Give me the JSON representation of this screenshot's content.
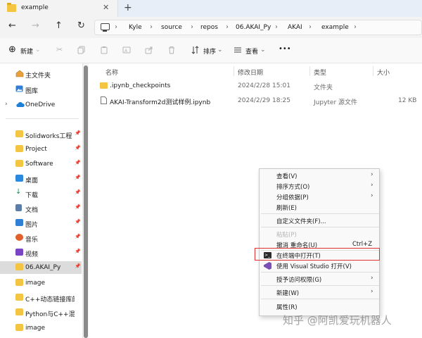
{
  "tab": {
    "title": "example",
    "close": "✕",
    "add": "+"
  },
  "nav": {
    "back": "←",
    "forward": "→",
    "up": "↑",
    "refresh": "↻"
  },
  "breadcrumb": [
    "Kyle",
    "source",
    "repos",
    "06.AKAI_Py",
    "AKAI",
    "example"
  ],
  "breadcrumb_sep": "›",
  "toolbar": {
    "new_label": "新建",
    "sort_label": "排序",
    "view_label": "查看",
    "more": "•••"
  },
  "sidebar": {
    "top": [
      {
        "label": "主文件夹",
        "icon": "home-icon"
      },
      {
        "label": "图库",
        "icon": "gallery-icon"
      },
      {
        "label": "OneDrive",
        "icon": "cloud-icon"
      }
    ],
    "items": [
      {
        "label": "Solidworks工程",
        "icon": "folder-icon",
        "pinned": true
      },
      {
        "label": "Project",
        "icon": "folder-icon",
        "pinned": true
      },
      {
        "label": "Software",
        "icon": "folder-icon",
        "pinned": true
      },
      {
        "label": "桌面",
        "icon": "desktop-icon",
        "pinned": true
      },
      {
        "label": "下载",
        "icon": "download-icon",
        "pinned": true
      },
      {
        "label": "文档",
        "icon": "documents-icon",
        "pinned": true
      },
      {
        "label": "图片",
        "icon": "pictures-icon",
        "pinned": true
      },
      {
        "label": "音乐",
        "icon": "music-icon",
        "pinned": true
      },
      {
        "label": "视频",
        "icon": "video-icon",
        "pinned": true
      },
      {
        "label": "06.AKAI_Py",
        "icon": "folder-icon",
        "pinned": true,
        "selected": true
      },
      {
        "label": "image",
        "icon": "folder-icon",
        "pinned": false
      },
      {
        "label": "C++动态链接库的生成",
        "icon": "folder-icon",
        "pinned": false
      },
      {
        "label": "Python与C++混合开发",
        "icon": "folder-icon",
        "pinned": false
      },
      {
        "label": "image",
        "icon": "folder-icon",
        "pinned": false
      }
    ]
  },
  "table": {
    "headers": {
      "name": "名称",
      "date": "修改日期",
      "type": "类型",
      "size": "大小"
    },
    "rows": [
      {
        "name": ".ipynb_checkpoints",
        "date": "2024/2/28 15:01",
        "type": "文件夹",
        "size": "",
        "icon": "folder-icon"
      },
      {
        "name": "AKAI-Transform2d测试样例.ipynb",
        "date": "2024/2/29 18:25",
        "type": "Jupyter 源文件",
        "size": "12 KB",
        "icon": "file-icon"
      }
    ]
  },
  "context_menu": {
    "items": [
      {
        "label": "查看(V)",
        "submenu": true
      },
      {
        "label": "排序方式(O)",
        "submenu": true
      },
      {
        "label": "分组依据(P)",
        "submenu": true
      },
      {
        "label": "刷新(E)"
      },
      {
        "label": "自定义文件夹(F)..."
      },
      {
        "label": "粘贴(P)",
        "disabled": true
      },
      {
        "label": "撤消 重命名(U)",
        "shortcut": "Ctrl+Z"
      },
      {
        "label": "在终端中打开(T)",
        "icon": "terminal-icon",
        "highlighted": true
      },
      {
        "label": "使用 Visual Studio 打开(V)",
        "icon": "visual-studio-icon"
      },
      {
        "label": "授予访问权限(G)",
        "submenu": true
      },
      {
        "label": "新建(W)",
        "submenu": true
      },
      {
        "label": "属性(R)"
      }
    ],
    "submenu_arrow": "›"
  },
  "watermark": "知乎 @阿凯爱玩机器人",
  "colors": {
    "highlight_border": "#e03131",
    "folder": "#f4c542",
    "accent": "#0067c0"
  }
}
